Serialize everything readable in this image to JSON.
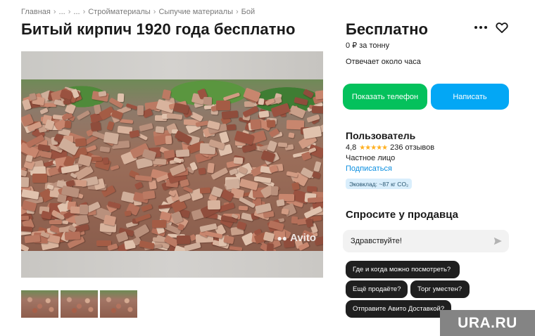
{
  "breadcrumb": {
    "items": [
      "Главная",
      "...",
      "...",
      "Стройматериалы",
      "Сыпучие материалы",
      "Бой"
    ],
    "separator": "›"
  },
  "listing": {
    "title": "Битый кирпич 1920 года бесплатно",
    "watermark": "Avito"
  },
  "price": {
    "title": "Бесплатно",
    "sub": "0 ₽ за тонну",
    "response": "Отвечает около часа"
  },
  "actions": {
    "show_phone": "Показать телефон",
    "write": "Написать"
  },
  "seller": {
    "name": "Пользователь",
    "rating": "4,8",
    "stars": "★★★★★",
    "reviews": "236 отзывов",
    "type": "Частное лицо",
    "subscribe": "Подписаться",
    "eco_badge": "Эковклад: ~87 кг CO₂"
  },
  "ask": {
    "title": "Спросите у продавца",
    "input_value": "Здравствуйте!",
    "chips": [
      "Где и когда можно посмотреть?",
      "Ещё продаёте?",
      "Торг уместен?",
      "Отправите Авито Доставкой?"
    ]
  },
  "watermark_logo": "URA.RU",
  "colors": {
    "phone_button": "#04c15c",
    "write_button": "#03a7f5",
    "link": "#0a8ee0",
    "star": "#ffb021",
    "chip": "#1f1f1f"
  },
  "icons": {
    "more": "more-dots-icon",
    "favorite": "heart-icon",
    "send": "send-icon"
  }
}
